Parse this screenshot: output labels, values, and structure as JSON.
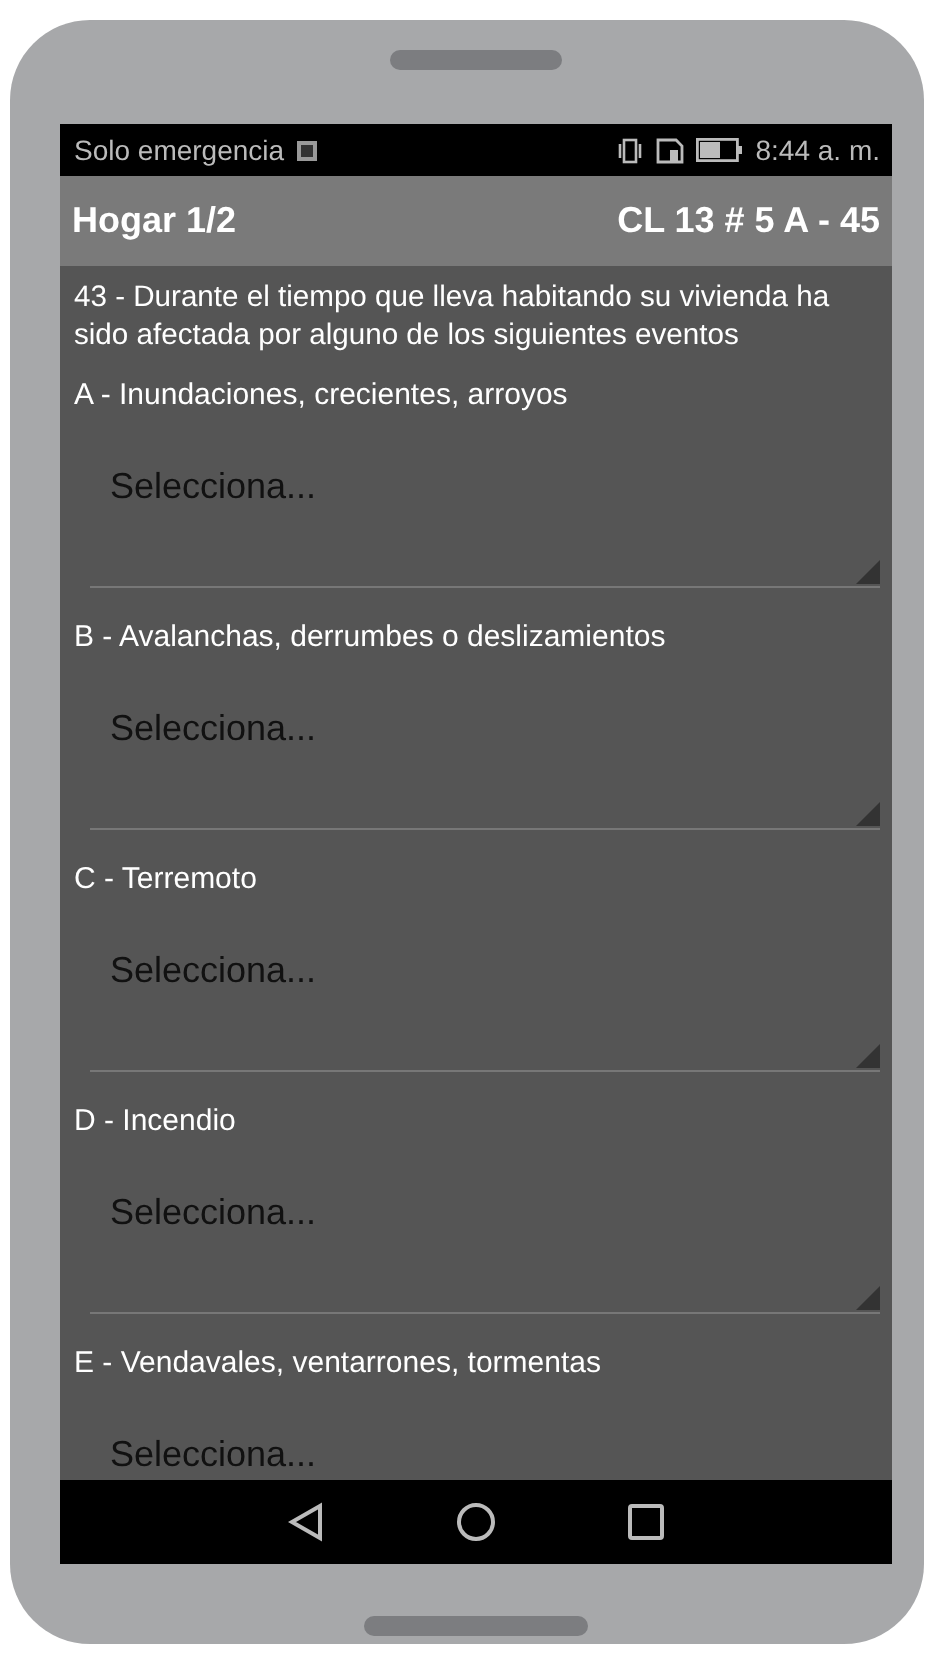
{
  "status_bar": {
    "carrier": "Solo emergencia",
    "time": "8:44 a. m."
  },
  "header": {
    "title": "Hogar 1/2",
    "address": "CL 13 # 5 A - 45"
  },
  "question": "43 - Durante el tiempo que lleva habitando su vivienda ha sido afectada por alguno de los siguientes eventos",
  "items": [
    {
      "label": "A - Inundaciones, crecientes, arroyos",
      "placeholder": "Selecciona..."
    },
    {
      "label": "B - Avalanchas, derrumbes o deslizamientos",
      "placeholder": "Selecciona..."
    },
    {
      "label": "C - Terremoto",
      "placeholder": "Selecciona..."
    },
    {
      "label": "D - Incendio",
      "placeholder": "Selecciona..."
    },
    {
      "label": "E - Vendavales, ventarrones, tormentas",
      "placeholder": "Selecciona..."
    }
  ]
}
